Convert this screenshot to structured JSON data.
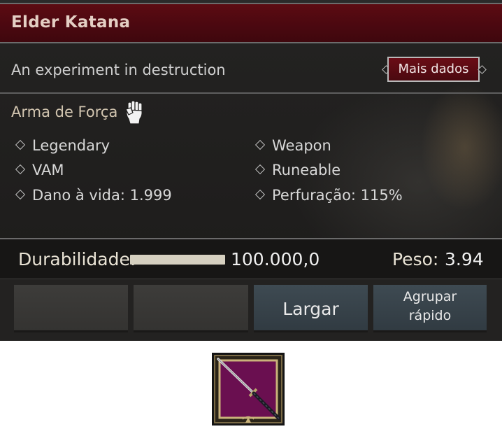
{
  "item": {
    "name": "Elder Katana",
    "description": "An experiment in destruction",
    "more_button": "Mais dados",
    "type_label": "Arma de Força",
    "type_icon": "fist-icon"
  },
  "properties": {
    "left": [
      "Legendary",
      "VAM",
      "Dano à vida: 1.999"
    ],
    "right": [
      "Weapon",
      "Runeable",
      "Perfuração: 115%"
    ]
  },
  "stats": {
    "durability_label": "Durabilidade:",
    "durability_value": "100.000,0",
    "durability_fill": 1.0,
    "weight_label": "Peso:",
    "weight_value": "3.94"
  },
  "actions": {
    "drop": "Largar",
    "quick_group_line1": "Agrupar",
    "quick_group_line2": "rápido"
  },
  "colors": {
    "title_bar": "#4a0810",
    "button_red": "#5c0b12",
    "icon_bg": "#6a0f50"
  }
}
